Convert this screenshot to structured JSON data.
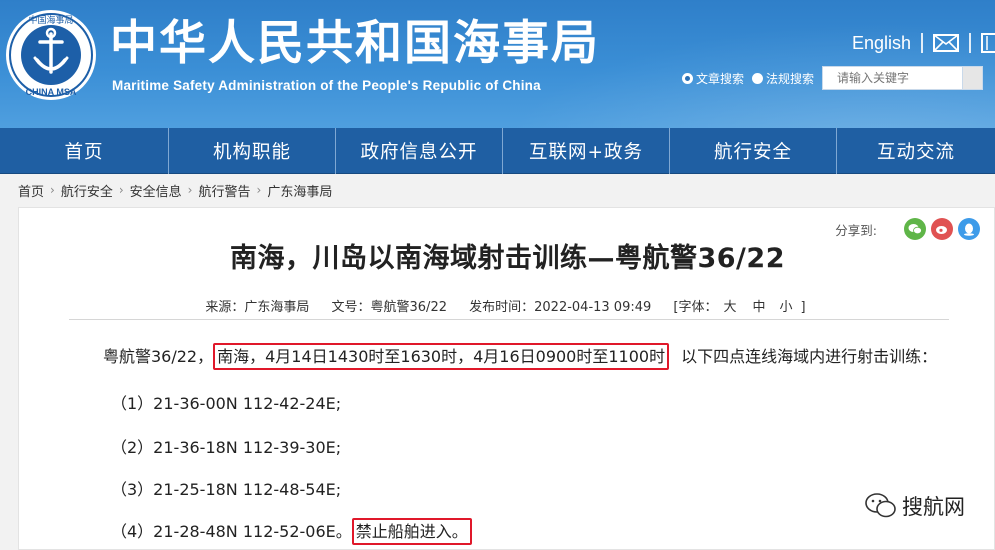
{
  "header": {
    "logo_top_text": "中国海事局",
    "logo_bottom_text": "CHINA MSA",
    "title_cn": "中华人民共和国海事局",
    "title_en": "Maritime Safety Administration of the People's Republic of China",
    "lang_link": "English",
    "search": {
      "option_article": "文章搜索",
      "option_law": "法规搜索",
      "placeholder": "请输入关键字"
    }
  },
  "nav": {
    "items": [
      "首页",
      "机构职能",
      "政府信息公开",
      "互联网+政务",
      "航行安全",
      "互动交流"
    ]
  },
  "breadcrumb": [
    "首页",
    "航行安全",
    "安全信息",
    "航行警告",
    "广东海事局"
  ],
  "share": {
    "label": "分享到:"
  },
  "article": {
    "title": "南海，川岛以南海域射击训练—粤航警36/22",
    "meta": {
      "source": "来源：广东海事局",
      "doc_no": "文号：粤航警36/22",
      "publish_time": "发布时间：2022-04-13 09:49",
      "font_size_label": "[字体：",
      "font_large": "大",
      "font_medium": "中",
      "font_small": "小",
      "font_close": "]"
    },
    "p1_prefix": "粤航警36/22，",
    "p1_highlight": "南海，4月14日1430时至1630时，4月16日0900时至1100时",
    "p1_suffix": "以下四点连线海域内进行射击训练：",
    "points": [
      "（1）21-36-00N 112-42-24E;",
      "（2）21-36-18N 112-39-30E;",
      "（3）21-25-18N 112-48-54E;",
      "（4）21-28-48N 112-52-06E。"
    ],
    "p5_highlight": "禁止船舶进入。"
  },
  "watermark": "搜航网",
  "colors": {
    "header_blue": "#3b8fd6",
    "nav_blue": "#1f5fa3",
    "highlight_red": "#e0182a"
  }
}
